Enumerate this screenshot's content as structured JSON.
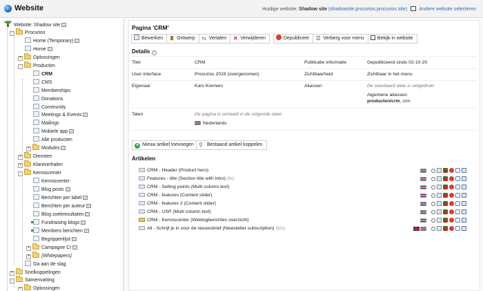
{
  "header": {
    "app_title": "Website",
    "current_site_label": "Huidige website:",
    "current_site_name": "Shadow site",
    "current_site_url": "(shadowsite.procurios.procurios.site",
    "current_site_url_close": ")",
    "switch_site_label": "Andere website selecteren"
  },
  "sidebar": {
    "rows": [
      {
        "label": "Website: Shadow site",
        "level": 0,
        "icon": "site",
        "hidden": true
      },
      {
        "label": "Procurios",
        "level": 1,
        "icon": "folder",
        "toggle": "-"
      },
      {
        "label": "Home (Temporary)",
        "level": 2,
        "icon": "page",
        "hidden": true
      },
      {
        "label": "Home",
        "level": 2,
        "icon": "page",
        "hidden": true
      },
      {
        "label": "Oplossingen",
        "level": 2,
        "icon": "folder",
        "toggle": "+"
      },
      {
        "label": "Producten",
        "level": 2,
        "icon": "folder",
        "toggle": "-"
      },
      {
        "label": "CRM",
        "level": 3,
        "icon": "page",
        "bold": true
      },
      {
        "label": "CMS",
        "level": 3,
        "icon": "page"
      },
      {
        "label": "Memberships",
        "level": 3,
        "icon": "page"
      },
      {
        "label": "Donations",
        "level": 3,
        "icon": "page"
      },
      {
        "label": "Community",
        "level": 3,
        "icon": "page"
      },
      {
        "label": "Meetings & Events",
        "level": 3,
        "icon": "page",
        "hidden": true
      },
      {
        "label": "Mailings",
        "level": 3,
        "icon": "page"
      },
      {
        "label": "Mobiele app",
        "level": 3,
        "icon": "page",
        "hidden": true
      },
      {
        "label": "Alle producten",
        "level": 3,
        "icon": "page"
      },
      {
        "label": "Modules",
        "level": 3,
        "icon": "folder",
        "toggle": "+",
        "hidden": true
      },
      {
        "label": "Diensten",
        "level": 2,
        "icon": "folder",
        "toggle": "+"
      },
      {
        "label": "Klantverhalen",
        "level": 2,
        "icon": "folder",
        "toggle": "+"
      },
      {
        "label": "Kenniscenter",
        "level": 2,
        "icon": "folder",
        "toggle": "-"
      },
      {
        "label": "Kenniscenter",
        "level": 3,
        "icon": "page"
      },
      {
        "label": "Blog posts",
        "level": 3,
        "icon": "page",
        "hidden": true
      },
      {
        "label": "Berichten per label",
        "level": 3,
        "icon": "page",
        "hidden": true
      },
      {
        "label": "Berichten per auteur",
        "level": 3,
        "icon": "page",
        "hidden": true
      },
      {
        "label": "Blog zoekresultaten",
        "level": 3,
        "icon": "page",
        "hidden": true
      },
      {
        "label": "Fundraising blogs",
        "level": 3,
        "icon": "page-link",
        "hidden": true
      },
      {
        "label": "Members berichten",
        "level": 3,
        "icon": "page-link",
        "hidden": true
      },
      {
        "label": "Begrippenlijst",
        "level": 3,
        "icon": "page",
        "hidden": true
      },
      {
        "label": "Campagne CI",
        "level": 3,
        "icon": "folder",
        "toggle": "+",
        "hidden": true
      },
      {
        "label": "{Whitepapers}",
        "level": 3,
        "icon": "folder",
        "toggle": "+",
        "italic": true
      },
      {
        "label": "Ga aan de slag",
        "level": 2,
        "icon": "page"
      },
      {
        "label": "Snelkoppelingen",
        "level": 1,
        "icon": "folder",
        "toggle": "+"
      },
      {
        "label": "Samenvatting",
        "level": 1,
        "icon": "folder",
        "toggle": "-"
      },
      {
        "label": "Oplossingen",
        "level": 2,
        "icon": "folder",
        "toggle": "+"
      }
    ]
  },
  "main": {
    "page_title": "Pagina 'CRM'",
    "toolbar": {
      "edit": "Bewerken",
      "design": "Ontwerp",
      "translate": "Vertalen",
      "delete": "Verwijderen",
      "unpublish": "Depubliceer",
      "hide_menu": "Verberg voor menu",
      "view_site": "Bekijk in website"
    },
    "details": {
      "title": "Details",
      "collapse_symbol": "−",
      "title_label": "Titel",
      "title_value": "CRM",
      "publication_label": "Publicatie informatie",
      "publication_value": "Gepubliceerd sinds 02-10-20",
      "ui_label": "User interface",
      "ui_value": "Procurios 2019 (overgenomen)",
      "visibility_label": "Zichtbaarheid",
      "visibility_value": "Zichtbaar in het menu",
      "owner_label": "Eigenaar",
      "owner_value": "Kars Kremers",
      "aliases_label": "Aliassen",
      "aliases_note": "De standaard alias is vetgedrukt",
      "general_aliases_label": "Algemene aliassen:",
      "alias_bold": "producten/crm",
      "alias_rest": ", crm",
      "languages_label": "Talen",
      "languages_note": "De pagina is vertaald in de volgende talen",
      "language_nl": "Nederlands"
    },
    "article_buttons": {
      "new": "Nieuw artikel toevoegen",
      "link": "Bestaand artikel koppelen"
    },
    "articles_title": "Artikelen",
    "articles": [
      {
        "label": "CRM - Header (Product hero)",
        "count": "",
        "flags": [
          "nl"
        ],
        "icon": "text"
      },
      {
        "label": "Features - title (Section title with intro)",
        "count": "(6x)",
        "flags": [
          "nl"
        ],
        "icon": "text"
      },
      {
        "label": "CRM - Selling points (Multi column text)",
        "count": "",
        "flags": [
          "nl"
        ],
        "icon": "text"
      },
      {
        "label": "CRM - features (Content slider)",
        "count": "",
        "flags": [
          "nl"
        ],
        "icon": "text"
      },
      {
        "label": "CRM - features 2 (Content slider)",
        "count": "",
        "flags": [
          "nl"
        ],
        "icon": "text"
      },
      {
        "label": "CRM - USP (Multi column text)",
        "count": "",
        "flags": [
          "nl"
        ],
        "icon": "text"
      },
      {
        "label": "CRM - Kenniscenter (Weblogberichten overzicht)",
        "count": "",
        "flags": [
          "nl"
        ],
        "icon": "blog"
      },
      {
        "label": "All - Schrijf je in voor de nieuwsbrief (Newsletter subscription)",
        "count": "(62x)",
        "flags": [
          "gb",
          "nl"
        ],
        "icon": "text"
      }
    ]
  }
}
